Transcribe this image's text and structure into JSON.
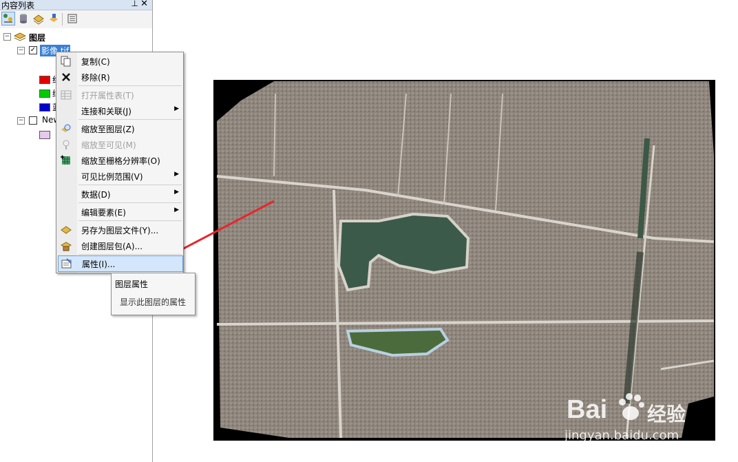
{
  "toc": {
    "title": "内容列表",
    "pin_icon": "⊥",
    "close_icon": "✕",
    "root_label": "图层",
    "layer1_label": "影像.tif",
    "layer1_checked": true,
    "bands": [
      {
        "label": "红",
        "color": "#e50000"
      },
      {
        "label": "绿",
        "color": "#00cc00"
      },
      {
        "label": "蓝",
        "color": "#0000cc"
      }
    ],
    "layer2_label": "New",
    "layer2_checked": false,
    "layer2_color": "#e8c8ec"
  },
  "context_menu": {
    "items": [
      {
        "label": "复制(C)",
        "icon": "copy-icon",
        "enabled": true,
        "submenu": false
      },
      {
        "label": "移除(R)",
        "icon": "remove-icon",
        "enabled": true,
        "submenu": false
      },
      {
        "label": "打开属性表(T)",
        "icon": "table-icon",
        "enabled": false,
        "submenu": false
      },
      {
        "label": "连接和关联(J)",
        "icon": "",
        "enabled": true,
        "submenu": true
      },
      {
        "label": "缩放至图层(Z)",
        "icon": "zoom-layer-icon",
        "enabled": true,
        "submenu": false
      },
      {
        "label": "缩放至可见(M)",
        "icon": "zoom-visible-icon",
        "enabled": false,
        "submenu": false
      },
      {
        "label": "缩放至栅格分辨率(O)",
        "icon": "zoom-raster-icon",
        "enabled": true,
        "submenu": false
      },
      {
        "label": "可见比例范围(V)",
        "icon": "",
        "enabled": true,
        "submenu": true
      },
      {
        "label": "数据(D)",
        "icon": "",
        "enabled": true,
        "submenu": true
      },
      {
        "label": "编辑要素(E)",
        "icon": "",
        "enabled": true,
        "submenu": true
      },
      {
        "label": "另存为图层文件(Y)...",
        "icon": "layer-file-icon",
        "enabled": true,
        "submenu": false
      },
      {
        "label": "创建图层包(A)...",
        "icon": "layer-package-icon",
        "enabled": true,
        "submenu": false
      },
      {
        "label": "属性(I)...",
        "icon": "properties-icon",
        "enabled": true,
        "submenu": false,
        "highlighted": true
      }
    ],
    "arrow_glyph": "▶"
  },
  "tooltip": {
    "title": "图层属性",
    "description": "显示此图层的属性"
  },
  "watermark": {
    "brand": "Bai",
    "brand2": "经验",
    "url": "jingyan.baidu.com"
  },
  "colors": {
    "annotation_arrow": "#e8262b",
    "menu_highlight": "#d4e6fb",
    "selected_layer": "#3b7fd4"
  }
}
